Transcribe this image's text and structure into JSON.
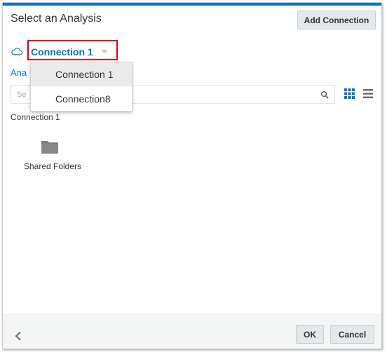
{
  "dialog": {
    "title": "Select an Analysis",
    "add_connection_label": "Add Connection",
    "accent_color": "#0572ce"
  },
  "connection": {
    "selected": "Connection 1",
    "icon": "cloud-icon",
    "options": [
      "Connection 1",
      "Connection8"
    ],
    "highlighted_option": "Connection 1"
  },
  "partial_link": "Ana",
  "search": {
    "placeholder_visible": "Se",
    "icon": "search-icon"
  },
  "view_toggles": [
    "grid-view-icon",
    "list-view-icon"
  ],
  "section_label": "Connection 1",
  "items": [
    {
      "label": "Shared Folders",
      "icon": "folder-icon"
    }
  ],
  "footer": {
    "back_icon": "chevron-left-icon",
    "ok_label": "OK",
    "cancel_label": "Cancel"
  }
}
